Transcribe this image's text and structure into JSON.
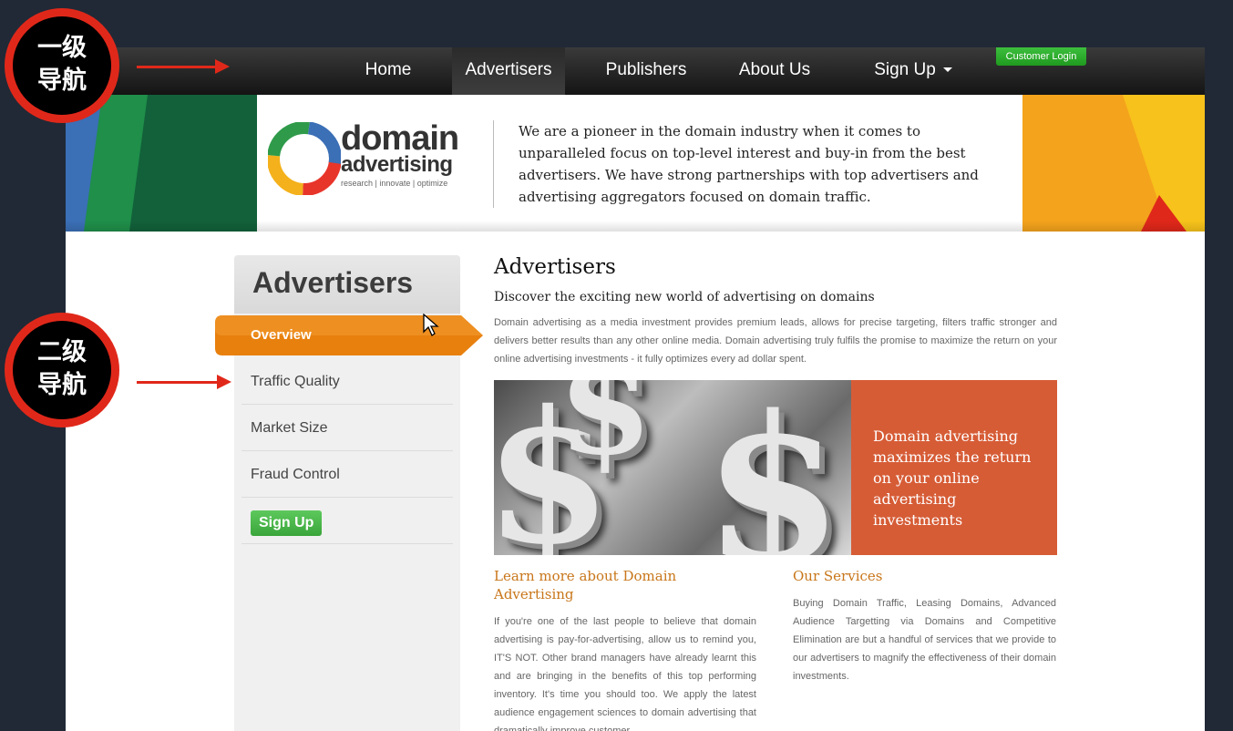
{
  "topnav": {
    "items": [
      "Home",
      "Advertisers",
      "Publishers",
      "About Us",
      "Sign Up"
    ],
    "active": "Advertisers",
    "customer_login": "Customer Login"
  },
  "banner": {
    "logo_word1": "domain",
    "logo_word2": "advertising",
    "logo_tagline": "research | innovate | optimize",
    "text": "We are a pioneer in the domain industry when it comes to unparalleled focus on top-level interest and buy-in from the best advertisers. We have strong partnerships with top advertisers and advertising aggregators focused on domain traffic."
  },
  "sidebar": {
    "title": "Advertisers",
    "items": [
      "Overview",
      "Traffic Quality",
      "Market Size",
      "Fraud Control"
    ],
    "signup_label": "Sign Up"
  },
  "main": {
    "title": "Advertisers",
    "subtitle": "Discover the exciting new world of advertising on domains",
    "intro": "Domain advertising as a media investment provides premium leads, allows for precise targeting, filters traffic stronger and delivers better results than any other online media. Domain advertising truly fulfils the promise to maximize the return on your online advertising investments - it fully optimizes every ad dollar spent.",
    "hero_text": "Domain advertising maximizes the return on your online advertising investments",
    "col1_title": "Learn more about Domain Advertising",
    "col1_body": "If you're one of the last people to believe that domain advertising is pay-for-advertising, allow us to remind you, IT'S NOT. Other brand managers have already learnt this and are bringing in the benefits of this top performing inventory. It's time you should too. We apply the latest audience engagement sciences to domain advertising that dramatically improve customer",
    "col2_title": "Our Services",
    "col2_body": "Buying Domain Traffic, Leasing Domains, Advanced Audience Targetting via Domains and Competitive Elimination are but a handful of services that we provide to our advertisers to magnify the effectiveness of their domain investments."
  },
  "annotations": {
    "primary_line1": "一级",
    "primary_line2": "导航",
    "secondary_line1": "二级",
    "secondary_line2": "导航"
  },
  "colors": {
    "annotation_red": "#e0281a",
    "orange_tab": "#e8800e",
    "accent_title": "#c8761a",
    "hero_box": "#d65c36",
    "green_button": "#3aa53a"
  }
}
